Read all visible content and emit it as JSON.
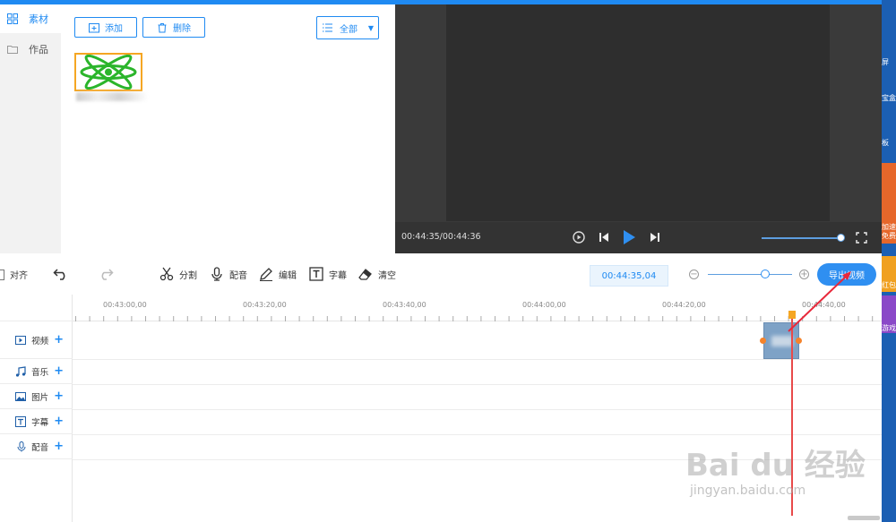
{
  "sidebar": {
    "items": [
      {
        "label": "素材",
        "icon": "grid-icon",
        "active": true
      },
      {
        "label": "作品",
        "icon": "folder-icon",
        "active": false
      }
    ]
  },
  "media": {
    "add_label": "添加",
    "delete_label": "删除",
    "filter_label": "全部"
  },
  "preview": {
    "time": "00:44:35/00:44:36"
  },
  "toolbar": {
    "align_label": "对齐",
    "split_label": "分割",
    "dub_label": "配音",
    "edit_label": "编辑",
    "subtitle_label": "字幕",
    "clear_label": "清空",
    "timecode": "00:44:35,04",
    "export_label": "导出视频"
  },
  "ruler": {
    "ticks": [
      "00:43:00,00",
      "00:43:20,00",
      "00:43:40,00",
      "00:44:00,00",
      "00:44:20,00",
      "00:44:40,00"
    ]
  },
  "tracks": [
    {
      "label": "视频",
      "icon": "video-icon"
    },
    {
      "label": "音乐",
      "icon": "music-icon"
    },
    {
      "label": "图片",
      "icon": "image-icon"
    },
    {
      "label": "字幕",
      "icon": "text-icon"
    },
    {
      "label": "配音",
      "icon": "mic-icon"
    }
  ],
  "right_strip": {
    "texts": [
      "屏",
      "宝盒",
      "板",
      "加速",
      "免费",
      "红包",
      "游戏"
    ]
  },
  "watermark": {
    "brand": "Bai du 经验",
    "url": "jingyan.baidu.com"
  },
  "colors": {
    "accent": "#1f8af2",
    "playhead": "#e84a4a",
    "clip": "#7ea2c6",
    "handle": "#f5832b"
  }
}
